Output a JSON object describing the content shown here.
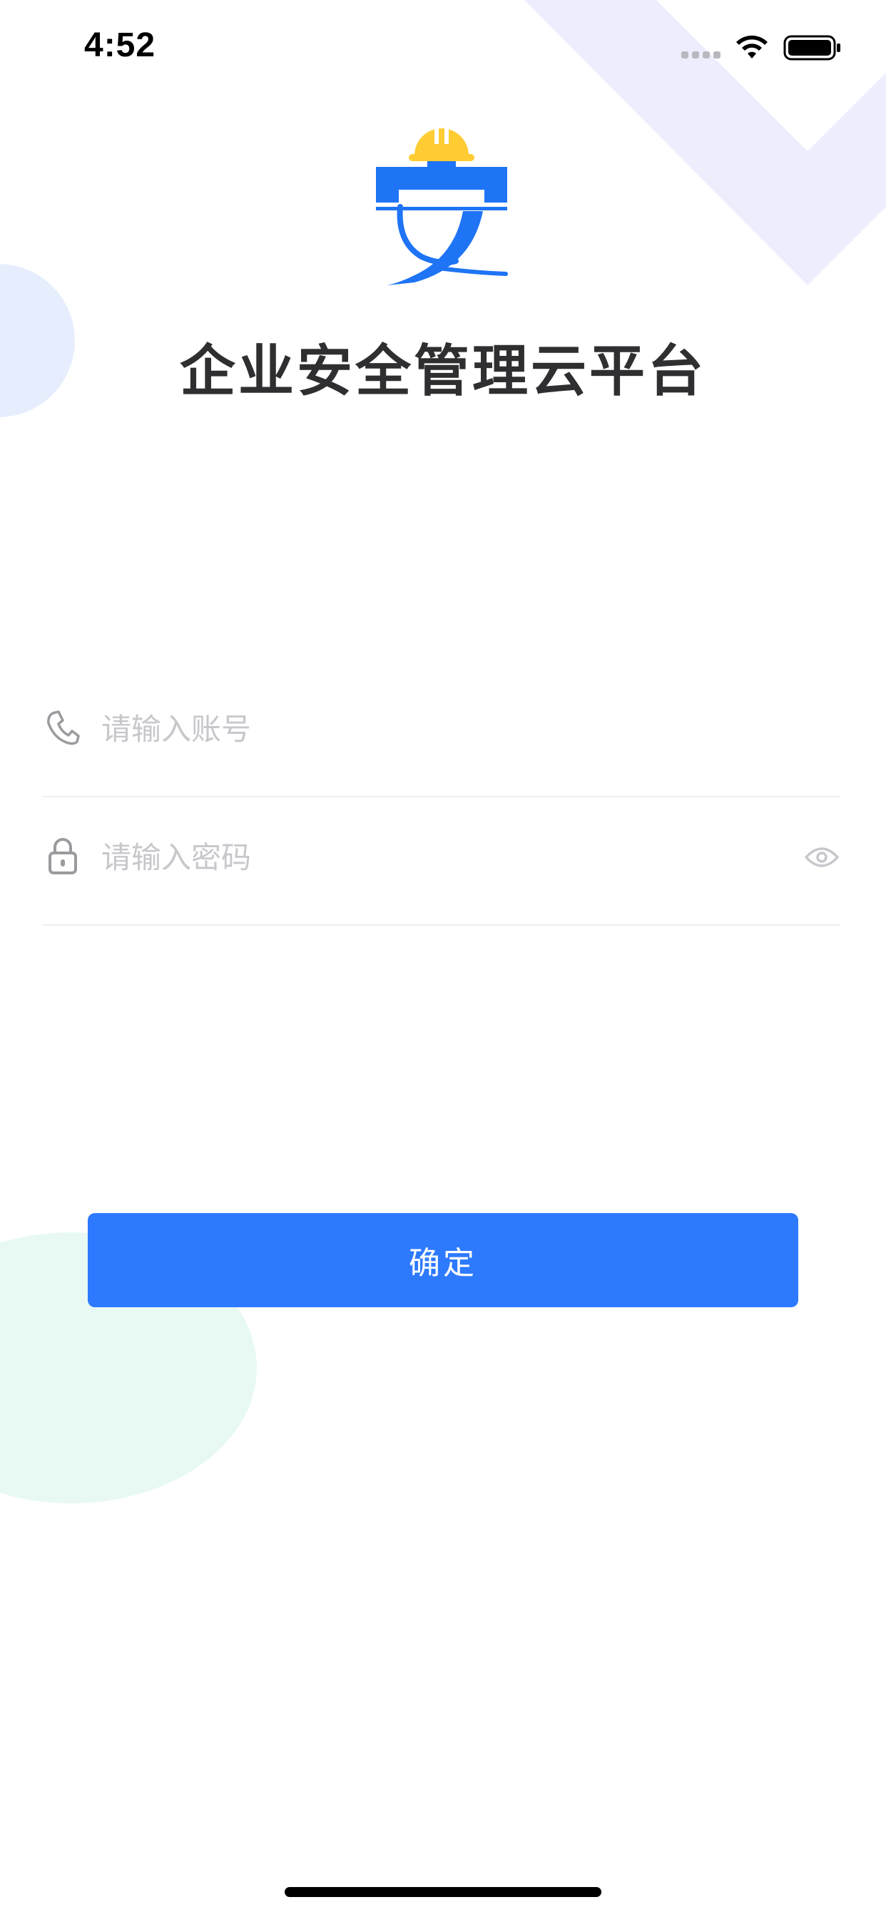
{
  "status_bar": {
    "time": "4:52",
    "signal_icon": "signal-dots-icon",
    "wifi_icon": "wifi-icon",
    "battery_icon": "battery-icon"
  },
  "logo": {
    "icon": "safety-helmet-logo-icon"
  },
  "title": "企业安全管理云平台",
  "login_form": {
    "account": {
      "icon": "phone-icon",
      "placeholder": "请输入账号",
      "value": ""
    },
    "password": {
      "icon": "lock-icon",
      "placeholder": "请输入密码",
      "value": "",
      "toggle_icon": "eye-icon"
    },
    "submit_label": "确定"
  },
  "colors": {
    "primary": "#2D7AFE",
    "helmet": "#FFCC33",
    "title_text": "#2F2F31",
    "placeholder": "#C7C7CC",
    "decor_lavender": "#ECEEFE",
    "decor_mint": "#E8F9F4"
  }
}
